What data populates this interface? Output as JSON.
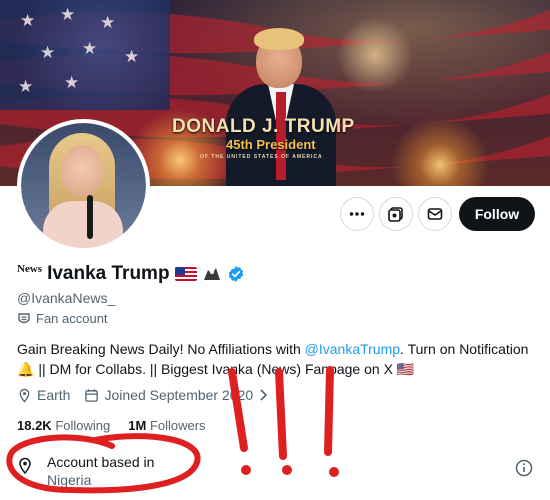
{
  "banner": {
    "title": "DONALD J. TRUMP",
    "subtitle": "45th President",
    "tagline": "OF THE UNITED STATES OF AMERICA"
  },
  "actions": {
    "follow_label": "Follow"
  },
  "profile": {
    "name_prefix": "News",
    "display_name": "Ivanka Trump",
    "handle": "@IvankaNews_",
    "label": "Fan account",
    "bio": {
      "part1": "Gain Breaking News Daily! No Affiliations with ",
      "mention": "@IvankaTrump",
      "part2": ". Turn on Notification 🔔 || DM for Collabs. || Biggest Ivanka (News) Fanpage on X 🇺🇸"
    },
    "location": "Earth",
    "joined": "Joined September 2020"
  },
  "stats": {
    "following_count": "18.2K",
    "following_label": "Following",
    "followers_count": "1M",
    "followers_label": "Followers"
  },
  "account_based": {
    "label": "Account based in",
    "value": "Nigeria"
  },
  "annotation": {
    "exclamation": "!!!"
  },
  "colors": {
    "accent": "#1d9bf0",
    "annotation_red": "#e02020",
    "follow_button": "#0f1419"
  }
}
